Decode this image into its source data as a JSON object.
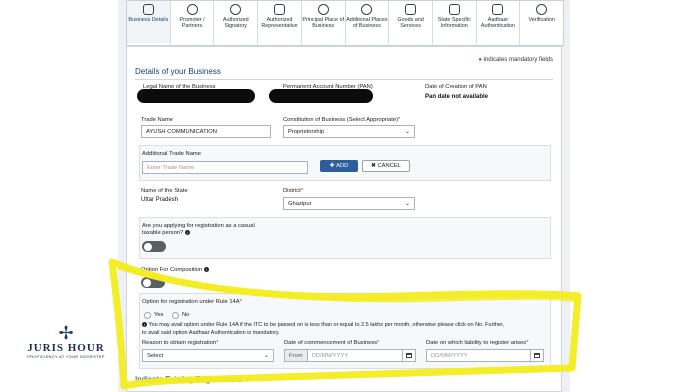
{
  "tabs": [
    {
      "label": "Business Details",
      "icon": "briefcase-icon",
      "active": true
    },
    {
      "label": "Promoter / Partners",
      "icon": "person-icon",
      "active": false
    },
    {
      "label": "Authorized Signatory",
      "icon": "signatory-icon",
      "active": false
    },
    {
      "label": "Authorized Representative",
      "icon": "representative-icon",
      "active": false
    },
    {
      "label": "Principal Place of Business",
      "icon": "location-pin-icon",
      "active": false
    },
    {
      "label": "Additional Places of Business",
      "icon": "location-pin-icon",
      "active": false
    },
    {
      "label": "Goods and Services",
      "icon": "goods-icon",
      "active": false
    },
    {
      "label": "State Specific Information",
      "icon": "document-icon",
      "active": false
    },
    {
      "label": "Aadhaar Authentication",
      "icon": "id-card-icon",
      "active": false
    },
    {
      "label": "Verification",
      "icon": "check-circle-icon",
      "active": false
    }
  ],
  "mandatory_note": "indicates mandatory fields",
  "section_title": "Details of your Business",
  "legal_name_label": "Legal Name of the Business",
  "pan_label": "Permanent Account Number (PAN)",
  "pan_date_label": "Date of Creation of PAN",
  "pan_date_value": "Pan date not available",
  "trade_name_label": "Trade Name",
  "trade_name_value": "AYUSH COMMUNICATION",
  "constitution_label": "Constitution of Business (Select Appropriate)",
  "constitution_value": "Proprietorship",
  "additional_trade_label": "Additional Trade Name",
  "additional_trade_placeholder": "Enter Trade Name",
  "add_button": "ADD",
  "cancel_button": "CANCEL",
  "state_label": "Name of the State",
  "state_value": "Uttar Pradesh",
  "district_label": "District",
  "district_value": "Ghazipur",
  "casual_label_1": "Are you applying for registration as a casual",
  "casual_label_2": "taxable person?",
  "composition_label": "Option For Composition",
  "rule14a_label": "Option for registration under Rule 14A",
  "radio_yes": "Yes",
  "radio_no": "No",
  "rule14a_note_1": "You may avail option under Rule 14A if the ITC to be passed on is less than or equal to 2.5 lakhs per month, otherwise please click on No. Further,",
  "rule14a_note_2": "to avail said option Aadhaar Authentication is mandatory.",
  "reason_label": "Reason to obtain registration",
  "reason_value": "Select",
  "commencement_label": "Date of commencement of Business",
  "date_prefix": "From",
  "date_placeholder": "DD/MM/YYYY",
  "liability_label": "Date on which liability to register arises",
  "existing_reg_title": "Indicate Existing Registrations",
  "logo": {
    "name": "JURIS HOUR",
    "tagline": "PROFICIENCY AT YOUR DOORSTEP"
  },
  "colors": {
    "highlight": "#f3ec1f",
    "accent": "#2e5d9c",
    "required": "#d32f2f"
  }
}
